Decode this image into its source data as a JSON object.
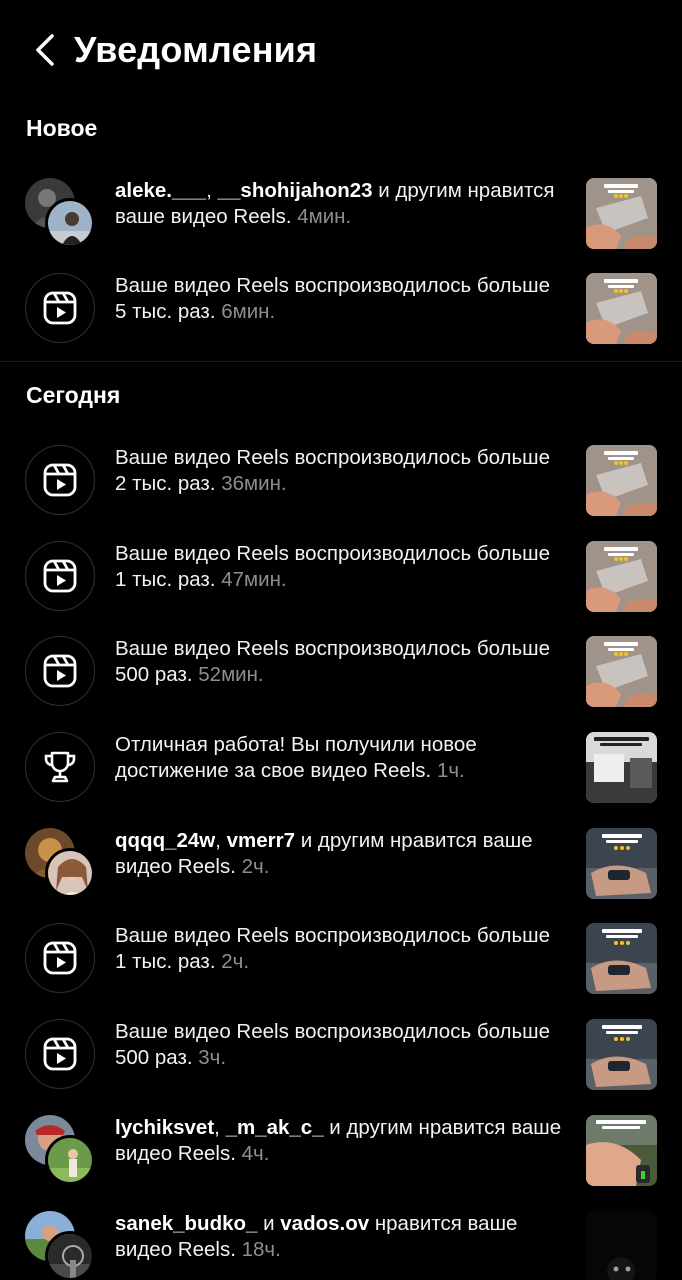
{
  "header": {
    "title": "Уведомления"
  },
  "sections": {
    "new": "Новое",
    "today": "Сегодня"
  },
  "items": [
    {
      "user1": "aleke.___",
      "sep": ", ",
      "user2": "__shohijahon23",
      "text": " и другим нравится ваше видео Reels. ",
      "time": "4мин."
    },
    {
      "text": "Ваше видео Reels воспроизводилось больше 5 тыс. раз. ",
      "time": "6мин."
    },
    {
      "text": "Ваше видео Reels воспроизводилось больше 2 тыс. раз. ",
      "time": "36мин."
    },
    {
      "text": "Ваше видео Reels воспроизводилось больше 1 тыс. раз. ",
      "time": "47мин."
    },
    {
      "text": "Ваше видео Reels воспроизводилось больше 500 раз. ",
      "time": "52мин."
    },
    {
      "text": "Отличная работа! Вы получили новое достижение за свое видео Reels. ",
      "time": "1ч."
    },
    {
      "user1": "qqqq_24w",
      "sep": ", ",
      "user2": "vmerr7",
      "text": " и другим нравится ваше видео Reels. ",
      "time": "2ч."
    },
    {
      "text": "Ваше видео Reels воспроизводилось больше 1 тыс. раз. ",
      "time": "2ч."
    },
    {
      "text": "Ваше видео Reels воспроизводилось больше 500 раз. ",
      "time": "3ч."
    },
    {
      "user1": "lychiksvet",
      "sep": ", ",
      "user2": "_m_ak_c_",
      "text": " и другим нравится ваше видео Reels. ",
      "time": "4ч."
    },
    {
      "user1": "sanek_budko_",
      "sep": " и ",
      "user2": "vados.ov",
      "text": " нравится ваше видео Reels. ",
      "time": "18ч."
    }
  ],
  "colors": {
    "background": "#000000",
    "secondary_text": "#8e8e8e",
    "divider": "#1c1c1c"
  },
  "icons": {
    "back": "chevron-left-icon",
    "reels": "reels-icon",
    "trophy": "trophy-icon"
  }
}
